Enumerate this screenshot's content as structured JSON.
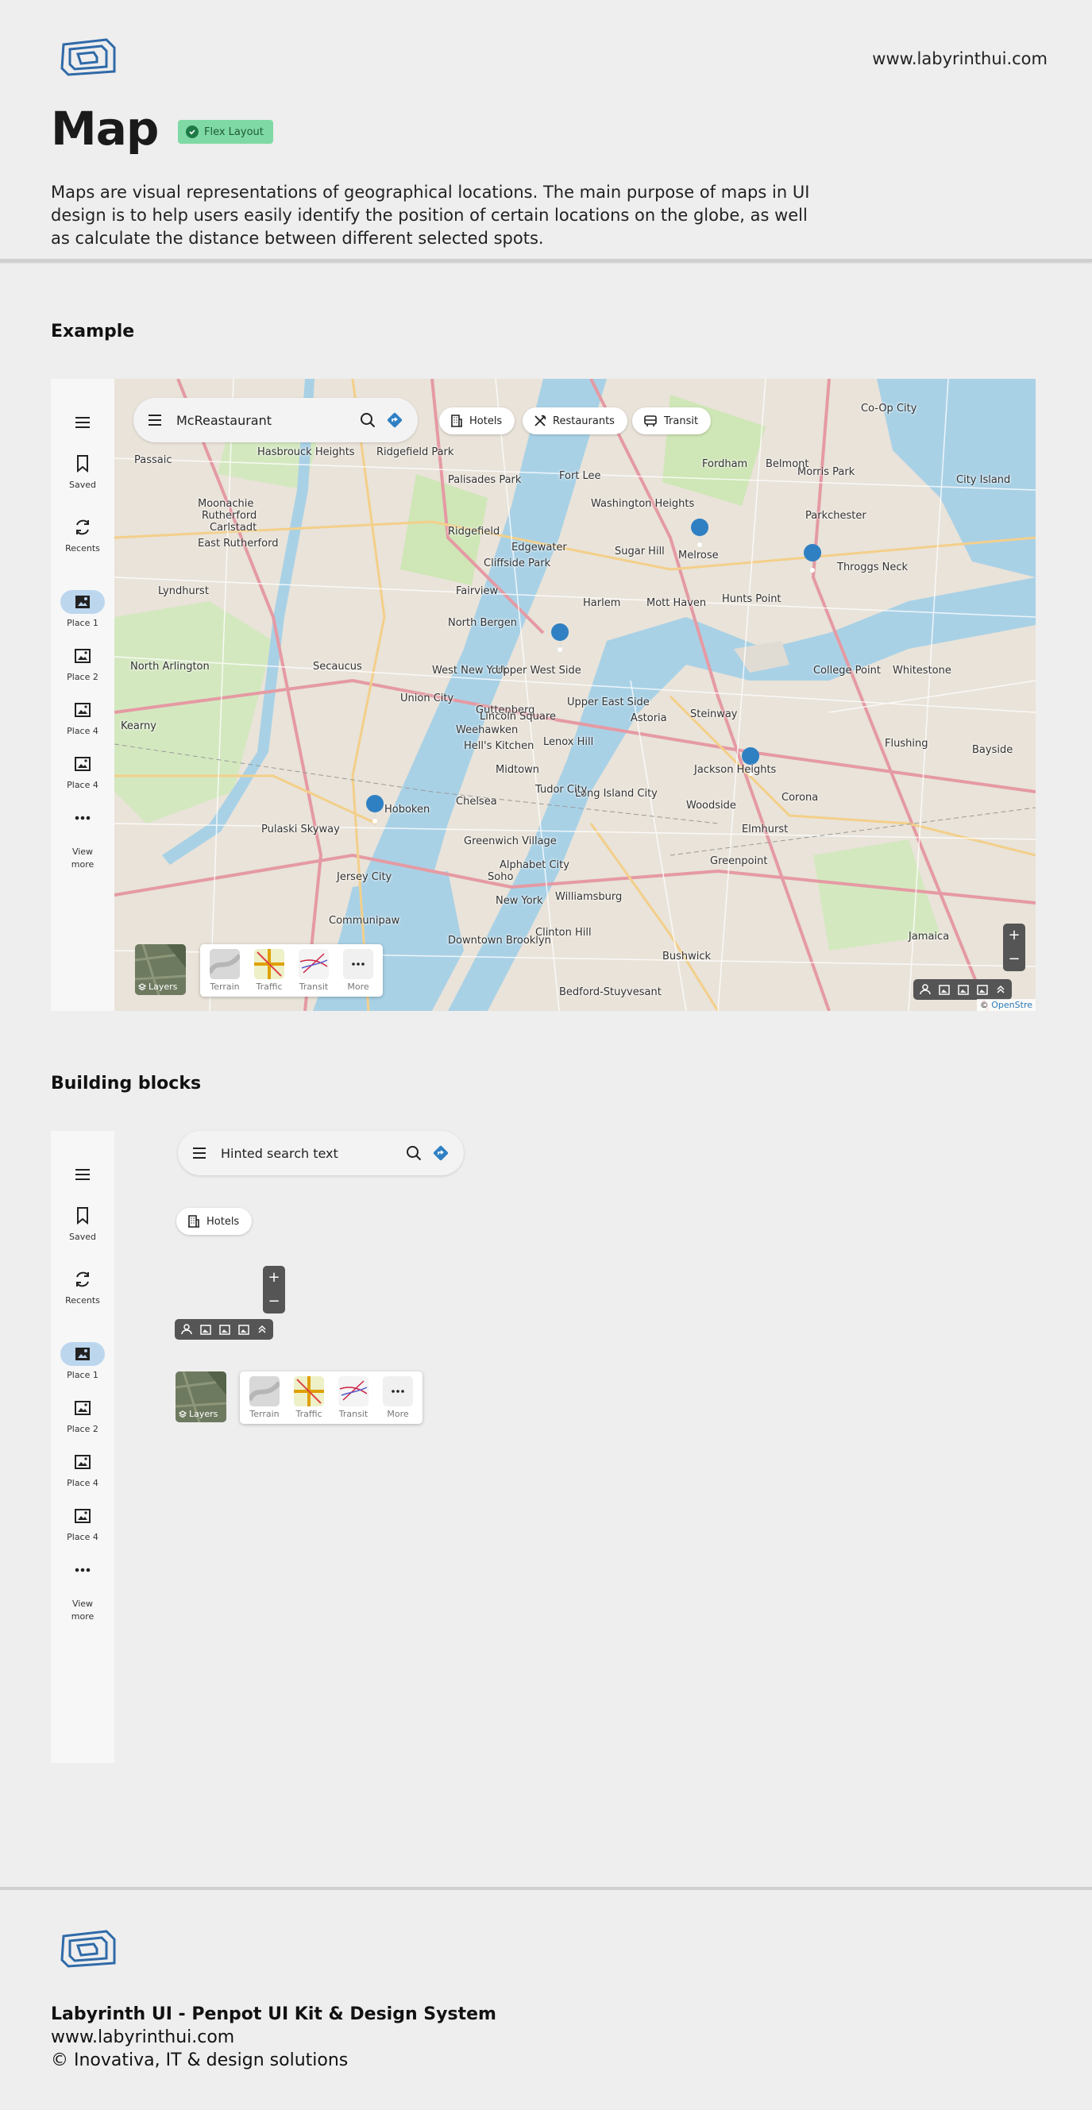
{
  "header": {
    "site_url": "www.labyrinthui.com",
    "title": "Map",
    "badge": "Flex Layout",
    "intro": "Maps are visual representations of geographical locations. The main purpose of maps in UI design is to help users easily identify the position of certain locations on the globe, as well as calculate the distance between different selected spots."
  },
  "sections": {
    "example": "Example",
    "building_blocks": "Building blocks"
  },
  "sidebar": {
    "items": [
      {
        "label": "",
        "icon": "menu-icon"
      },
      {
        "label": "Saved",
        "icon": "bookmark-icon"
      },
      {
        "label": "Recents",
        "icon": "recents-icon"
      },
      {
        "label": "Place 1",
        "icon": "image-icon",
        "active": true
      },
      {
        "label": "Place 2",
        "icon": "image-icon"
      },
      {
        "label": "Place 4",
        "icon": "image-icon"
      },
      {
        "label": "Place 4",
        "icon": "image-icon"
      },
      {
        "label": "View more",
        "icon": "more-icon"
      }
    ]
  },
  "map": {
    "search_value": "McReastaurant",
    "chips": [
      "Hotels",
      "Restaurants",
      "Transit"
    ],
    "layers_label": "Layers",
    "layer_options": [
      "Terrain",
      "Traffic",
      "Transit",
      "More"
    ],
    "zoom_in": "+",
    "zoom_out": "−",
    "attribution_prefix": "© ",
    "attribution_link": "OpenStre",
    "places": [
      "Passaic",
      "Hasbrouck Heights",
      "Ridgefield Park",
      "Palisades Park",
      "Fort Lee",
      "Washington Heights",
      "Sugar Hill",
      "Harlem",
      "Mott Haven",
      "Melrose",
      "Hunts Point",
      "Parkchester",
      "Throggs Neck",
      "City Island",
      "Morris Park",
      "Co-Op City",
      "Rutherford",
      "Lyndhurst",
      "North Arlington",
      "Kearny",
      "Secaucus",
      "North Bergen",
      "West New York",
      "Union City",
      "Guttenberg",
      "Weehawken",
      "Hoboken",
      "Jersey City",
      "Hell's Kitchen",
      "Upper West Side",
      "Upper East Side",
      "Midtown",
      "Chelsea",
      "Greenwich Village",
      "Astoria",
      "Long Island City",
      "Woodside",
      "Jackson Heights",
      "Elmhurst",
      "Corona",
      "Flushing",
      "Whitestone",
      "College Point",
      "Bayside",
      "Williamsburg",
      "Bushwick",
      "Downtown Brooklyn",
      "Clinton Hill",
      "Bedford-Stuyvesant",
      "New York",
      "Jamaica",
      "Fairview",
      "Cliffside Park",
      "Edgewater",
      "Ridgefield",
      "Moonachie",
      "Carlstadt",
      "East Rutherford",
      "Lincoln Square",
      "Alphabet City",
      "Tudor City",
      "Steinway",
      "Belmont",
      "Fordham",
      "Communipaw",
      "Pulaski Skyway",
      "Lenox Hill",
      "Greenpoint",
      "Soho"
    ]
  },
  "blocks": {
    "search_placeholder": "Hinted search text",
    "chip": "Hotels",
    "layers_label": "Layers",
    "layer_options": [
      "Terrain",
      "Traffic",
      "Transit",
      "More"
    ],
    "zoom_in": "+",
    "zoom_out": "−"
  },
  "footer": {
    "line1": "Labyrinth UI  - Penpot UI Kit & Design System",
    "line2": "www.labyrinthui.com",
    "line3": "© Inovativa, IT & design solutions"
  },
  "colors": {
    "accent": "#2f80c3",
    "badge_bg": "#7fd9a4",
    "sidebar_active": "#bcd6ee",
    "water": "#a9d1e6",
    "park": "#cde9b4"
  }
}
